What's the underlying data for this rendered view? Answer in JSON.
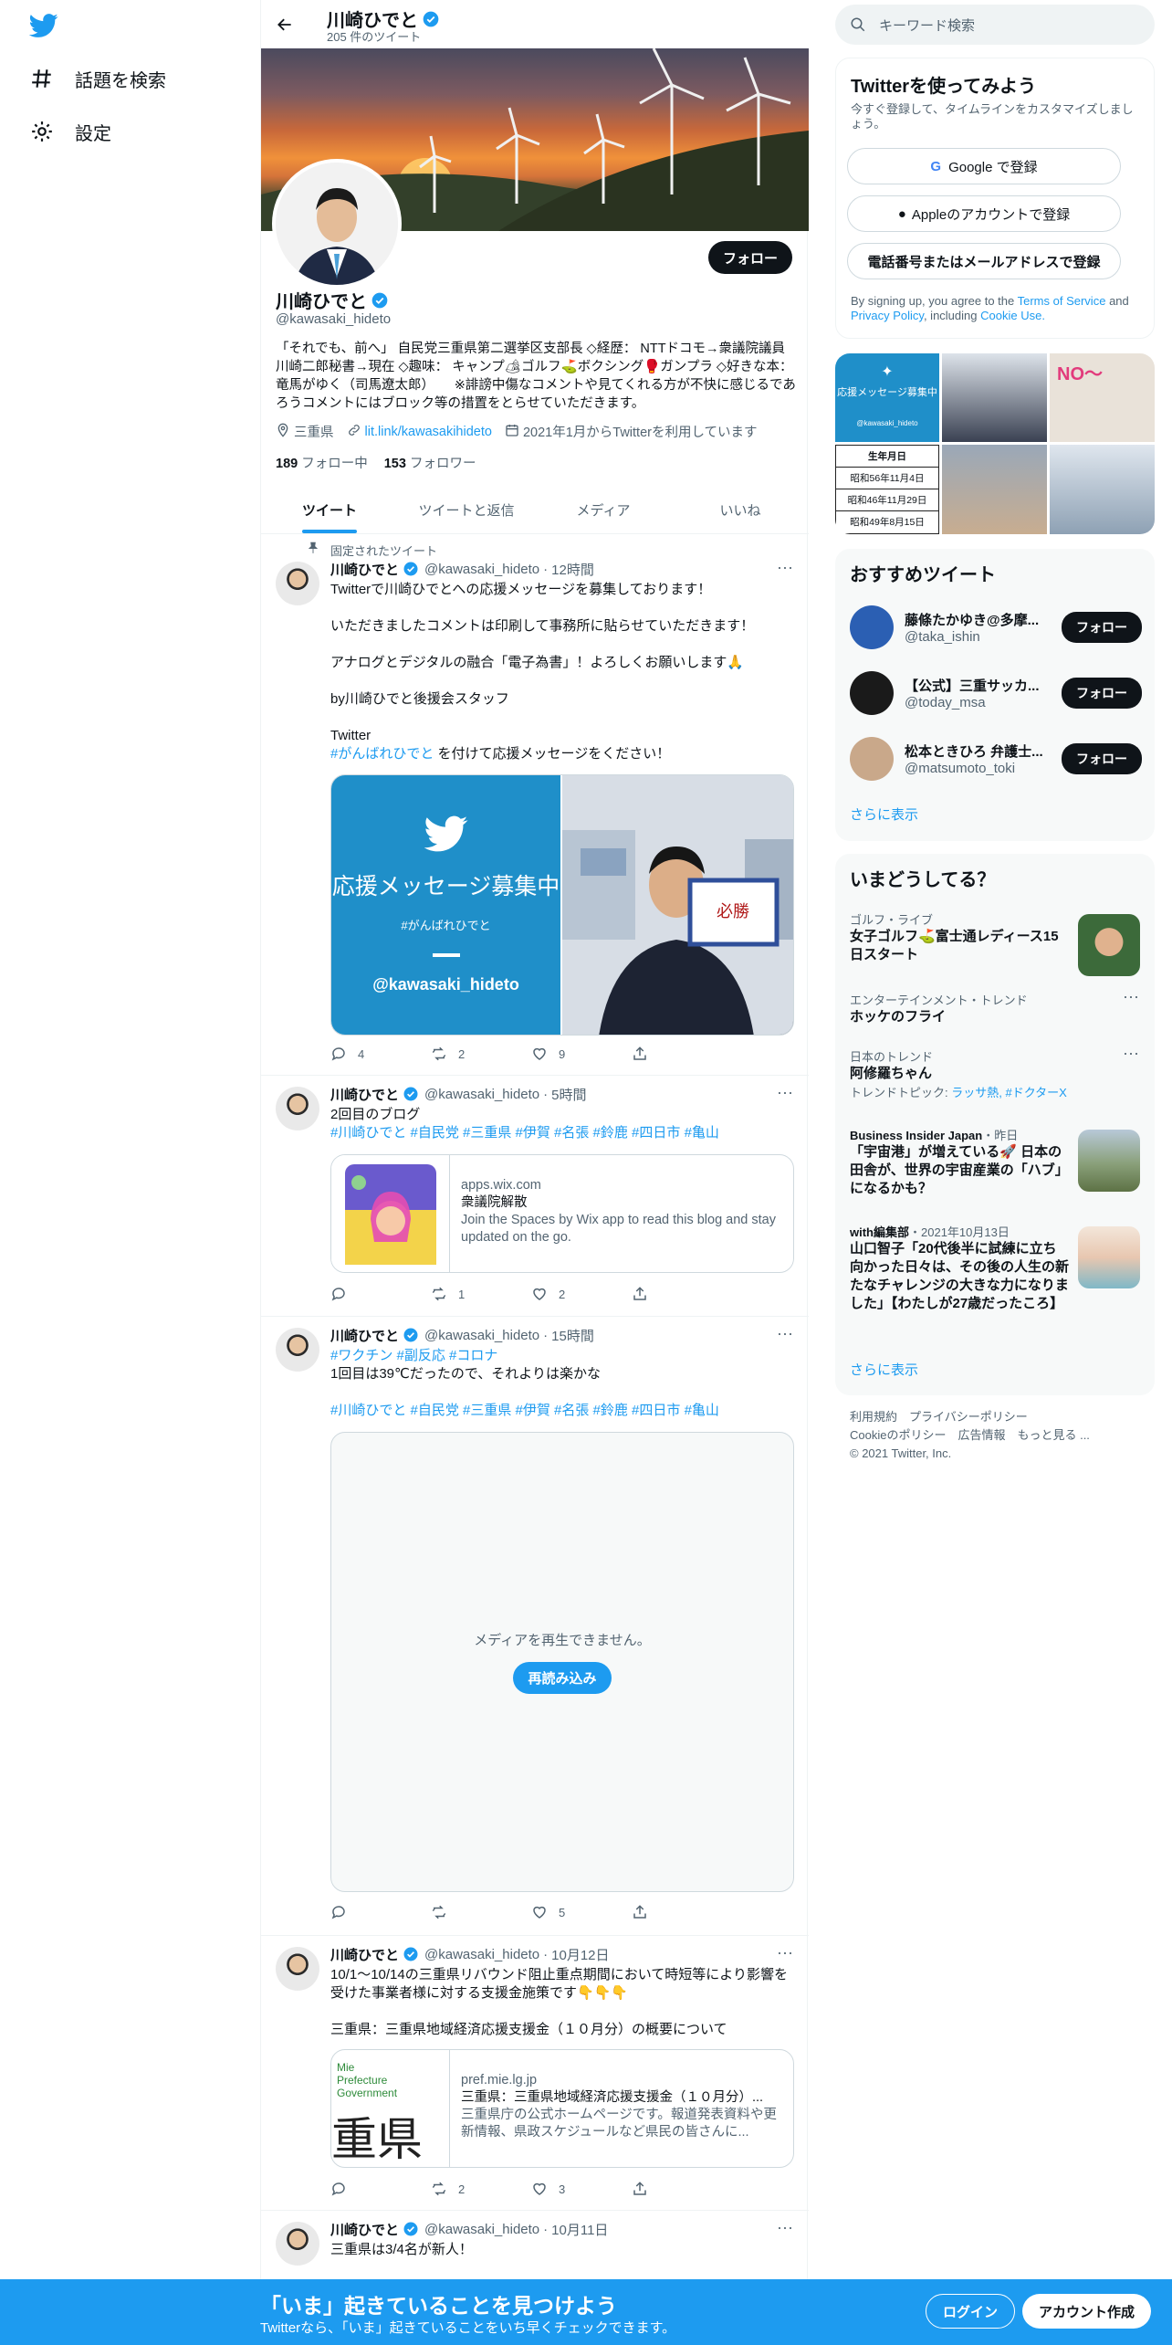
{
  "sidebar": {
    "logo_icon": "twitter-bird-icon",
    "items": [
      {
        "label": "話題を検索",
        "icon": "hashtag-icon"
      },
      {
        "label": "設定",
        "icon": "gear-icon"
      }
    ]
  },
  "header": {
    "name": "川崎ひでと",
    "tweet_count": "205 件のツイート"
  },
  "profile": {
    "name": "川崎ひでと",
    "handle": "@kawasaki_hideto",
    "follow_label": "フォロー",
    "bio": "「それでも、前へ」 自民党三重県第二選挙区支部長 ◇経歴： NTTドコモ→衆議院議員 川崎二郎秘書→現在 ◇趣味： キャンプ🏕ゴルフ⛳ボクシング🥊ガンプラ ◇好きな本： 竜馬がゆく（司馬遼太郎）　　※誹謗中傷なコメントや見てくれる方が不快に感じるであろうコメントにはブロック等の措置をとらせていただきます。",
    "location": "三重県",
    "link": "lit.link/kawasakihideto",
    "joined": "2021年1月からTwitterを利用しています",
    "following_count": "189",
    "following_label": "フォロー中",
    "followers_count": "153",
    "followers_label": "フォロワー"
  },
  "tabs": [
    "ツイート",
    "ツイートと返信",
    "メディア",
    "いいね"
  ],
  "tweets": [
    {
      "pinned_label": "固定されたツイート",
      "name": "川崎ひでと",
      "handle": "@kawasaki_hideto",
      "time": "12時間",
      "text": "Twitterで川崎ひでとへの応援メッセージを募集しております！\n\nいただきましたコメントは印刷して事務所に貼らせていただきます！\n\nアナログとデジタルの融合「電子為書」！よろしくお願いします🙏\n\nby川崎ひでと後援会スタッフ\n\nTwitter",
      "tag_line": "#がんばれひでと",
      "tag_suffix": " を付けて応援メッセージをください！",
      "media_title": "応援メッセージ募集中",
      "media_tag": "#がんばれひでと",
      "media_handle": "@kawasaki_hideto",
      "replies": "4",
      "retweets": "2",
      "likes": "9"
    },
    {
      "name": "川崎ひでと",
      "handle": "@kawasaki_hideto",
      "time": "5時間",
      "text": "2回目のブログ",
      "tags": "#川崎ひでと #自民党 #三重県 #伊賀 #名張 #鈴鹿 #四日市 #亀山",
      "card_domain": "apps.wix.com",
      "card_title": "衆議院解散",
      "card_desc": "Join the Spaces by Wix app to read this blog and stay updated on the go.",
      "replies": "",
      "retweets": "1",
      "likes": "2"
    },
    {
      "name": "川崎ひでと",
      "handle": "@kawasaki_hideto",
      "time": "15時間",
      "tags_top": "#ワクチン #副反応 #コロナ",
      "text": "1回目は39℃だったので、それよりは楽かな",
      "tags": "#川崎ひでと #自民党 #三重県 #伊賀 #名張 #鈴鹿 #四日市 #亀山",
      "video_msg": "メディアを再生できません。",
      "video_btn": "再読み込み",
      "replies": "",
      "retweets": "",
      "likes": "5"
    },
    {
      "name": "川崎ひでと",
      "handle": "@kawasaki_hideto",
      "time": "10月12日",
      "text": "10/1〜10/14の三重県リバウンド阻止重点期間において時短等により影響を受けた事業者様に対する支援金施策です👇👇👇\n\n三重県：三重県地域経済応援支援金（１０月分）の概要について",
      "card_domain": "pref.mie.lg.jp",
      "card_title": "三重県：三重県地域経済応援支援金（１０月分）...",
      "card_desc": "三重県庁の公式ホームページです。報道発表資料や更新情報、県政スケジュールなど県民の皆さんに...",
      "card_thumb_text1": "Mie",
      "card_thumb_text2": "Prefecture",
      "card_thumb_text3": "Government",
      "card_thumb_big": "重県",
      "replies": "",
      "retweets": "2",
      "likes": "3"
    },
    {
      "name": "川崎ひでと",
      "handle": "@kawasaki_hideto",
      "time": "10月11日",
      "text": "三重県は3/4名が新人！"
    }
  ],
  "right": {
    "search_placeholder": "キーワード検索",
    "signup": {
      "title": "Twitterを使ってみよう",
      "subtitle": "今すぐ登録して、タイムラインをカスタマイズしましょう。",
      "google": "Google で登録",
      "apple": "Appleのアカウントで登録",
      "phone": "電話番号またはメールアドレスで登録",
      "legal_prefix": "By signing up, you agree to the",
      "terms": "Terms of Service",
      "and": "and",
      "privacy": "Privacy Policy",
      "including": ", including",
      "cookie": "Cookie Use."
    },
    "photo_grid": {
      "t1": "応援メッセージ募集中",
      "t2": "@kawasaki_hideto",
      "t3": "NO〜",
      "birth_title": "生年月日",
      "birth1": "昭和56年11月4日",
      "birth2": "昭和46年11月29日",
      "birth3": "昭和49年8月15日"
    },
    "recommend": {
      "title": "おすすめツイート",
      "users": [
        {
          "name": "藤條たかゆき@多摩...",
          "handle": "@taka_ishin",
          "color": "#2b5fb3"
        },
        {
          "name": "【公式】三重サッカ...",
          "handle": "@today_msa",
          "color": "#1a1a1a"
        },
        {
          "name": "松本ときひろ 弁護士...",
          "handle": "@matsumoto_toki",
          "color": "#c9a88a"
        }
      ],
      "follow": "フォロー",
      "more": "さらに表示"
    },
    "trends": {
      "title": "いまどうしてる？",
      "items": [
        {
          "cat": "ゴルフ・ライブ",
          "title": "女子ゴルフ⛳富士通レディース15日スタート"
        },
        {
          "cat": "エンターテインメント・トレンド",
          "title": "ホッケのフライ"
        },
        {
          "cat": "日本のトレンド",
          "title": "阿修羅ちゃん",
          "sub_prefix": "トレンドトピック: ",
          "sub_tags": "ラッサ熱, #ドクターX"
        },
        {
          "cat": "Business Insider Japan",
          "cat_time": "・昨日",
          "title": "「宇宙港」が増えている🚀 日本の田舎が、世界の宇宙産業の「ハブ」になるかも？"
        },
        {
          "cat": "with編集部",
          "cat_time": "・2021年10月13日",
          "title": "山口智子「20代後半に試練に立ち向かった日々は、その後の人生の新たなチャレンジの大きな力になりました」【わたしが27歳だったころ】"
        }
      ],
      "more": "さらに表示"
    },
    "footer": {
      "line1": "利用規約　プライバシーポリシー",
      "line2": "Cookieのポリシー　広告情報　もっと見る ...",
      "line3": "© 2021 Twitter, Inc."
    }
  },
  "bottom_bar": {
    "title": "「いま」起きていることを見つけよう",
    "subtitle": "Twitterなら、「いま」起きていることをいち早くチェックできます。",
    "login": "ログイン",
    "signup": "アカウント作成"
  },
  "colors": {
    "accent": "#1d9bf0",
    "text": "#0f1419",
    "muted": "#536471"
  }
}
